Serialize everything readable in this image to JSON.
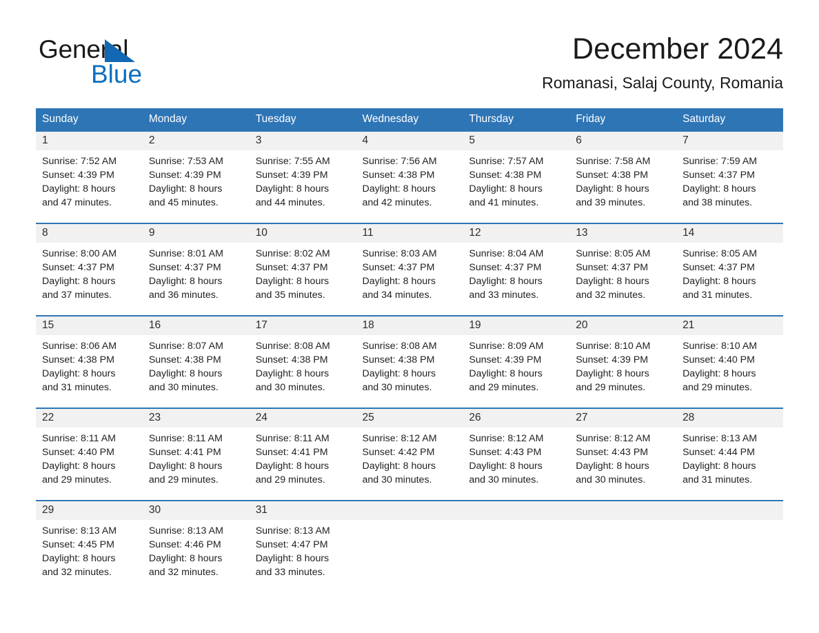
{
  "brand": {
    "name_part1": "General",
    "name_part2": "Blue",
    "triangle_color": "#1268b3",
    "blue_color": "#0b6fc0"
  },
  "header": {
    "title": "December 2024",
    "subtitle": "Romanasi, Salaj County, Romania"
  },
  "theme": {
    "header_blue": "#2e75b6",
    "date_band_gray": "#f1f1f1",
    "rule_blue": "#2e75b6"
  },
  "weekday_headers": [
    "Sunday",
    "Monday",
    "Tuesday",
    "Wednesday",
    "Thursday",
    "Friday",
    "Saturday"
  ],
  "weeks": [
    {
      "dates": [
        "1",
        "2",
        "3",
        "4",
        "5",
        "6",
        "7"
      ],
      "cells": [
        {
          "sunrise": "Sunrise: 7:52 AM",
          "sunset": "Sunset: 4:39 PM",
          "daylight_1": "Daylight: 8 hours",
          "daylight_2": "and 47 minutes."
        },
        {
          "sunrise": "Sunrise: 7:53 AM",
          "sunset": "Sunset: 4:39 PM",
          "daylight_1": "Daylight: 8 hours",
          "daylight_2": "and 45 minutes."
        },
        {
          "sunrise": "Sunrise: 7:55 AM",
          "sunset": "Sunset: 4:39 PM",
          "daylight_1": "Daylight: 8 hours",
          "daylight_2": "and 44 minutes."
        },
        {
          "sunrise": "Sunrise: 7:56 AM",
          "sunset": "Sunset: 4:38 PM",
          "daylight_1": "Daylight: 8 hours",
          "daylight_2": "and 42 minutes."
        },
        {
          "sunrise": "Sunrise: 7:57 AM",
          "sunset": "Sunset: 4:38 PM",
          "daylight_1": "Daylight: 8 hours",
          "daylight_2": "and 41 minutes."
        },
        {
          "sunrise": "Sunrise: 7:58 AM",
          "sunset": "Sunset: 4:38 PM",
          "daylight_1": "Daylight: 8 hours",
          "daylight_2": "and 39 minutes."
        },
        {
          "sunrise": "Sunrise: 7:59 AM",
          "sunset": "Sunset: 4:37 PM",
          "daylight_1": "Daylight: 8 hours",
          "daylight_2": "and 38 minutes."
        }
      ]
    },
    {
      "dates": [
        "8",
        "9",
        "10",
        "11",
        "12",
        "13",
        "14"
      ],
      "cells": [
        {
          "sunrise": "Sunrise: 8:00 AM",
          "sunset": "Sunset: 4:37 PM",
          "daylight_1": "Daylight: 8 hours",
          "daylight_2": "and 37 minutes."
        },
        {
          "sunrise": "Sunrise: 8:01 AM",
          "sunset": "Sunset: 4:37 PM",
          "daylight_1": "Daylight: 8 hours",
          "daylight_2": "and 36 minutes."
        },
        {
          "sunrise": "Sunrise: 8:02 AM",
          "sunset": "Sunset: 4:37 PM",
          "daylight_1": "Daylight: 8 hours",
          "daylight_2": "and 35 minutes."
        },
        {
          "sunrise": "Sunrise: 8:03 AM",
          "sunset": "Sunset: 4:37 PM",
          "daylight_1": "Daylight: 8 hours",
          "daylight_2": "and 34 minutes."
        },
        {
          "sunrise": "Sunrise: 8:04 AM",
          "sunset": "Sunset: 4:37 PM",
          "daylight_1": "Daylight: 8 hours",
          "daylight_2": "and 33 minutes."
        },
        {
          "sunrise": "Sunrise: 8:05 AM",
          "sunset": "Sunset: 4:37 PM",
          "daylight_1": "Daylight: 8 hours",
          "daylight_2": "and 32 minutes."
        },
        {
          "sunrise": "Sunrise: 8:05 AM",
          "sunset": "Sunset: 4:37 PM",
          "daylight_1": "Daylight: 8 hours",
          "daylight_2": "and 31 minutes."
        }
      ]
    },
    {
      "dates": [
        "15",
        "16",
        "17",
        "18",
        "19",
        "20",
        "21"
      ],
      "cells": [
        {
          "sunrise": "Sunrise: 8:06 AM",
          "sunset": "Sunset: 4:38 PM",
          "daylight_1": "Daylight: 8 hours",
          "daylight_2": "and 31 minutes."
        },
        {
          "sunrise": "Sunrise: 8:07 AM",
          "sunset": "Sunset: 4:38 PM",
          "daylight_1": "Daylight: 8 hours",
          "daylight_2": "and 30 minutes."
        },
        {
          "sunrise": "Sunrise: 8:08 AM",
          "sunset": "Sunset: 4:38 PM",
          "daylight_1": "Daylight: 8 hours",
          "daylight_2": "and 30 minutes."
        },
        {
          "sunrise": "Sunrise: 8:08 AM",
          "sunset": "Sunset: 4:38 PM",
          "daylight_1": "Daylight: 8 hours",
          "daylight_2": "and 30 minutes."
        },
        {
          "sunrise": "Sunrise: 8:09 AM",
          "sunset": "Sunset: 4:39 PM",
          "daylight_1": "Daylight: 8 hours",
          "daylight_2": "and 29 minutes."
        },
        {
          "sunrise": "Sunrise: 8:10 AM",
          "sunset": "Sunset: 4:39 PM",
          "daylight_1": "Daylight: 8 hours",
          "daylight_2": "and 29 minutes."
        },
        {
          "sunrise": "Sunrise: 8:10 AM",
          "sunset": "Sunset: 4:40 PM",
          "daylight_1": "Daylight: 8 hours",
          "daylight_2": "and 29 minutes."
        }
      ]
    },
    {
      "dates": [
        "22",
        "23",
        "24",
        "25",
        "26",
        "27",
        "28"
      ],
      "cells": [
        {
          "sunrise": "Sunrise: 8:11 AM",
          "sunset": "Sunset: 4:40 PM",
          "daylight_1": "Daylight: 8 hours",
          "daylight_2": "and 29 minutes."
        },
        {
          "sunrise": "Sunrise: 8:11 AM",
          "sunset": "Sunset: 4:41 PM",
          "daylight_1": "Daylight: 8 hours",
          "daylight_2": "and 29 minutes."
        },
        {
          "sunrise": "Sunrise: 8:11 AM",
          "sunset": "Sunset: 4:41 PM",
          "daylight_1": "Daylight: 8 hours",
          "daylight_2": "and 29 minutes."
        },
        {
          "sunrise": "Sunrise: 8:12 AM",
          "sunset": "Sunset: 4:42 PM",
          "daylight_1": "Daylight: 8 hours",
          "daylight_2": "and 30 minutes."
        },
        {
          "sunrise": "Sunrise: 8:12 AM",
          "sunset": "Sunset: 4:43 PM",
          "daylight_1": "Daylight: 8 hours",
          "daylight_2": "and 30 minutes."
        },
        {
          "sunrise": "Sunrise: 8:12 AM",
          "sunset": "Sunset: 4:43 PM",
          "daylight_1": "Daylight: 8 hours",
          "daylight_2": "and 30 minutes."
        },
        {
          "sunrise": "Sunrise: 8:13 AM",
          "sunset": "Sunset: 4:44 PM",
          "daylight_1": "Daylight: 8 hours",
          "daylight_2": "and 31 minutes."
        }
      ]
    },
    {
      "dates": [
        "29",
        "30",
        "31",
        "",
        "",
        "",
        ""
      ],
      "cells": [
        {
          "sunrise": "Sunrise: 8:13 AM",
          "sunset": "Sunset: 4:45 PM",
          "daylight_1": "Daylight: 8 hours",
          "daylight_2": "and 32 minutes."
        },
        {
          "sunrise": "Sunrise: 8:13 AM",
          "sunset": "Sunset: 4:46 PM",
          "daylight_1": "Daylight: 8 hours",
          "daylight_2": "and 32 minutes."
        },
        {
          "sunrise": "Sunrise: 8:13 AM",
          "sunset": "Sunset: 4:47 PM",
          "daylight_1": "Daylight: 8 hours",
          "daylight_2": "and 33 minutes."
        },
        {
          "sunrise": "",
          "sunset": "",
          "daylight_1": "",
          "daylight_2": ""
        },
        {
          "sunrise": "",
          "sunset": "",
          "daylight_1": "",
          "daylight_2": ""
        },
        {
          "sunrise": "",
          "sunset": "",
          "daylight_1": "",
          "daylight_2": ""
        },
        {
          "sunrise": "",
          "sunset": "",
          "daylight_1": "",
          "daylight_2": ""
        }
      ]
    }
  ]
}
